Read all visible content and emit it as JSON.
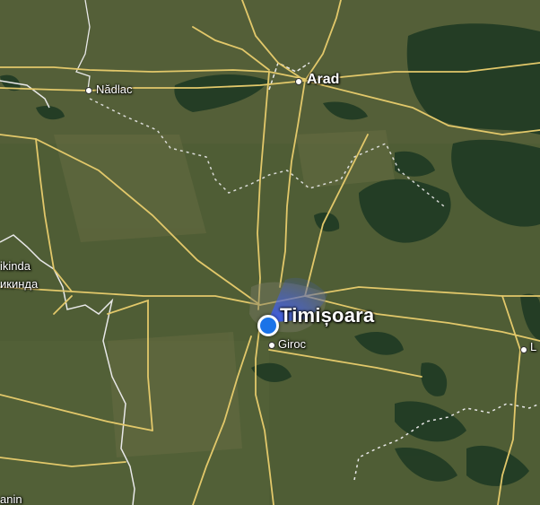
{
  "map": {
    "type": "satellite",
    "places": {
      "arad": "Arad",
      "nadlac": "Nădlac",
      "kikinda_latin": "ikinda",
      "kikinda_cyrillic": "икинда",
      "timisoara": "Timișoara",
      "giroc": "Giroc",
      "lugoj_partial": "L",
      "bottom_left_partial": "anin"
    },
    "colors": {
      "roads": "#e2c86a",
      "borders": "#e8e8e8",
      "location": "#1a73e8",
      "direction_cone": "#3a5cff"
    },
    "icons": {
      "current_location": "blue-location-dot",
      "direction": "heading-cone"
    }
  }
}
